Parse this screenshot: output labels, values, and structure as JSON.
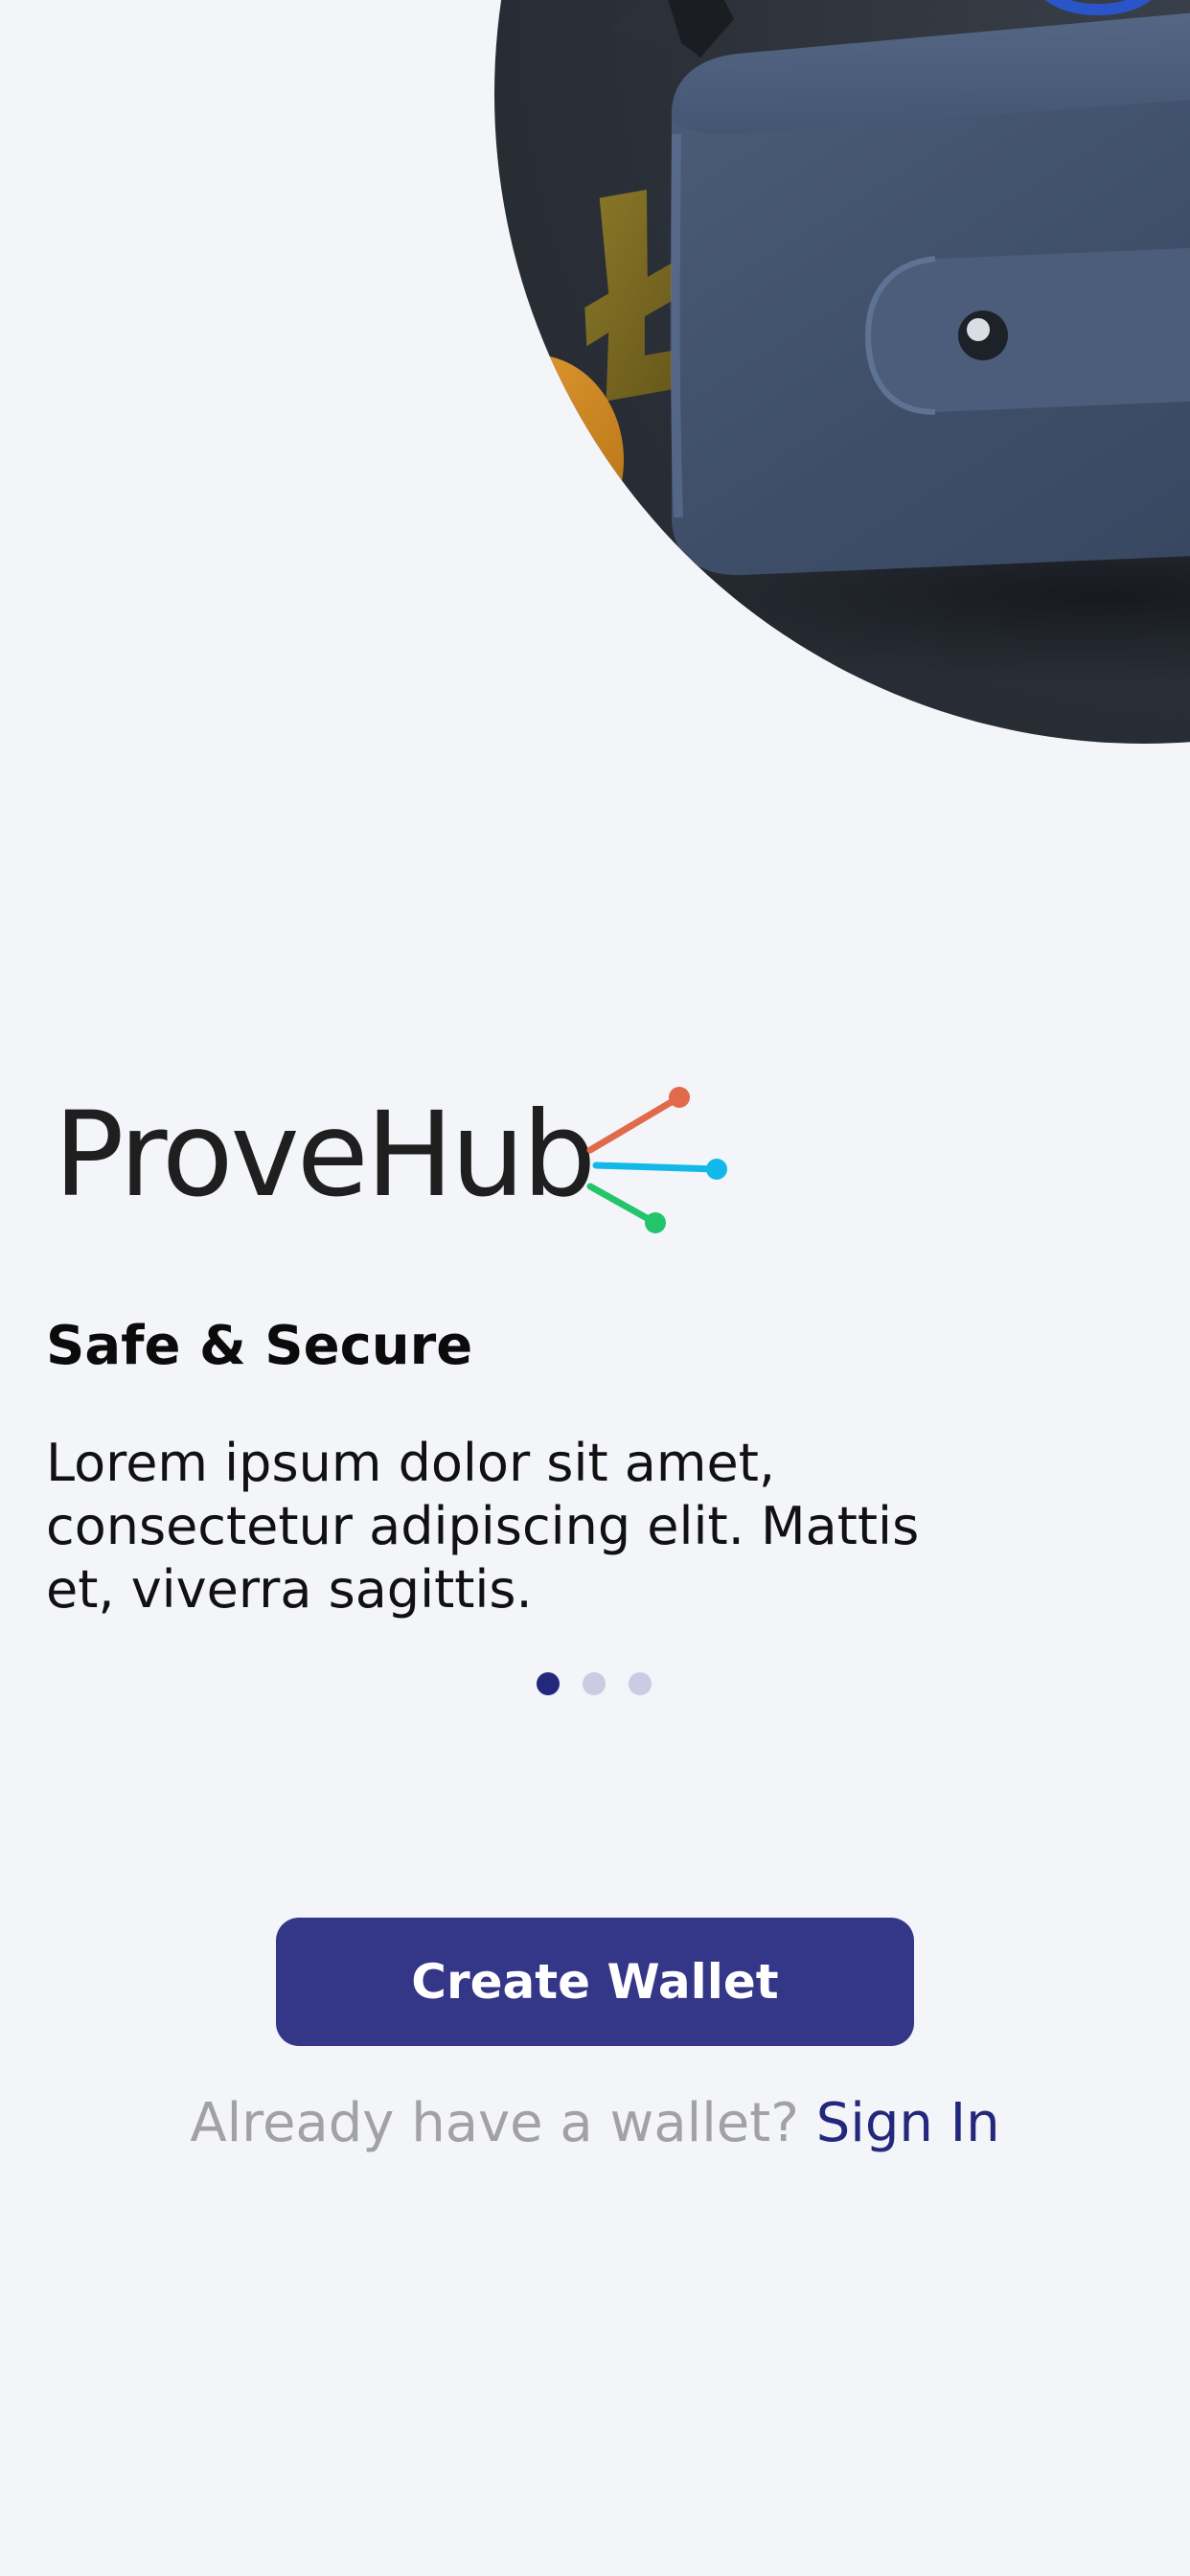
{
  "brand": {
    "name": "ProveHub",
    "text_color": "#1f1f1f",
    "node_colors": [
      "#E06A4A",
      "#12B9E8",
      "#22C56A"
    ]
  },
  "onboarding": {
    "title": "Safe & Secure",
    "description": "Lorem ipsum dolor sit amet, consectetur adipiscing elit. Mattis et, viverra sagittis.",
    "pages_total": 3,
    "active_page": 1
  },
  "actions": {
    "create_wallet_label": "Create Wallet",
    "signin_prompt": "Already have a wallet?",
    "signin_link": "Sign In"
  },
  "colors": {
    "background": "#F3F5F9",
    "primary": "#343687",
    "dot_active": "#23287C",
    "dot_inactive": "#C9CCE2",
    "muted_text": "#A2A2A6"
  },
  "icons": {
    "hero": "wallet-illustration",
    "logo_mark": "network-nodes-icon"
  }
}
